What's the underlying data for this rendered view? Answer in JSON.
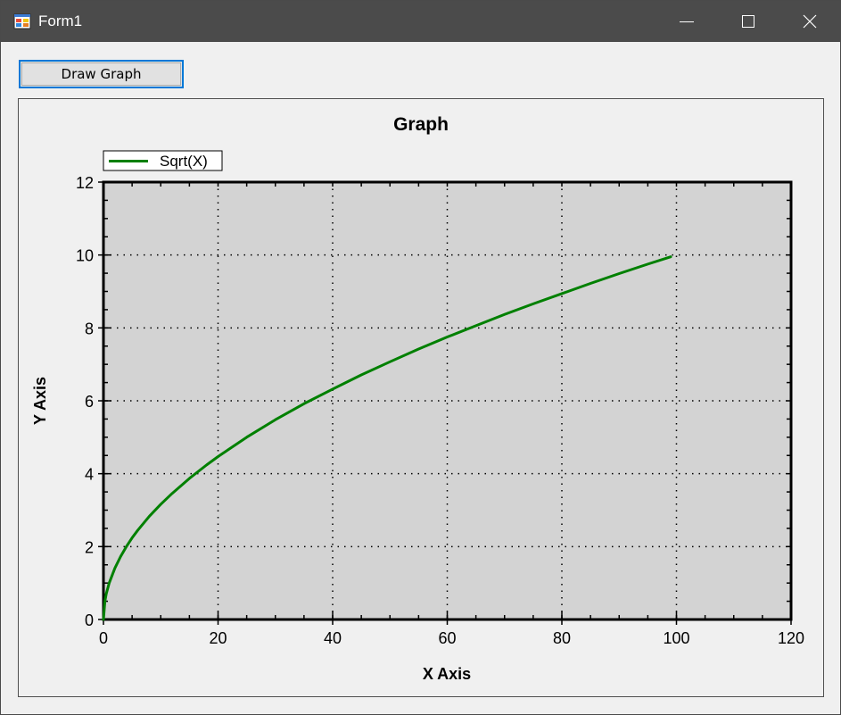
{
  "window": {
    "title": "Form1"
  },
  "toolbar": {
    "draw_graph_label": "Draw Graph"
  },
  "colors": {
    "titlebar": "#4b4b4b",
    "plot_background": "#d3d3d3",
    "series_line": "#008000",
    "button_focus": "#0078d7"
  },
  "chart_data": {
    "type": "line",
    "title": "Graph",
    "xlabel": "X Axis",
    "ylabel": "Y Axis",
    "xlim": [
      0,
      120
    ],
    "ylim": [
      0,
      12
    ],
    "x_ticks": [
      0,
      20,
      40,
      60,
      80,
      100,
      120
    ],
    "y_ticks": [
      0,
      2,
      4,
      6,
      8,
      10,
      12
    ],
    "grid": "dotted",
    "legend_position": "top-left",
    "series": [
      {
        "name": "Sqrt(X)",
        "color": "#008000",
        "x": [
          0,
          0.25,
          0.5,
          1,
          2,
          3,
          4,
          5,
          6,
          8,
          10,
          12,
          15,
          18,
          20,
          25,
          30,
          35,
          40,
          45,
          50,
          55,
          60,
          65,
          70,
          75,
          80,
          85,
          90,
          95,
          99
        ],
        "y": [
          0,
          0.5,
          0.71,
          1,
          1.41,
          1.73,
          2,
          2.24,
          2.45,
          2.83,
          3.16,
          3.46,
          3.87,
          4.24,
          4.47,
          5,
          5.48,
          5.92,
          6.32,
          6.71,
          7.07,
          7.42,
          7.75,
          8.06,
          8.37,
          8.66,
          8.94,
          9.22,
          9.49,
          9.75,
          9.95
        ]
      }
    ]
  }
}
